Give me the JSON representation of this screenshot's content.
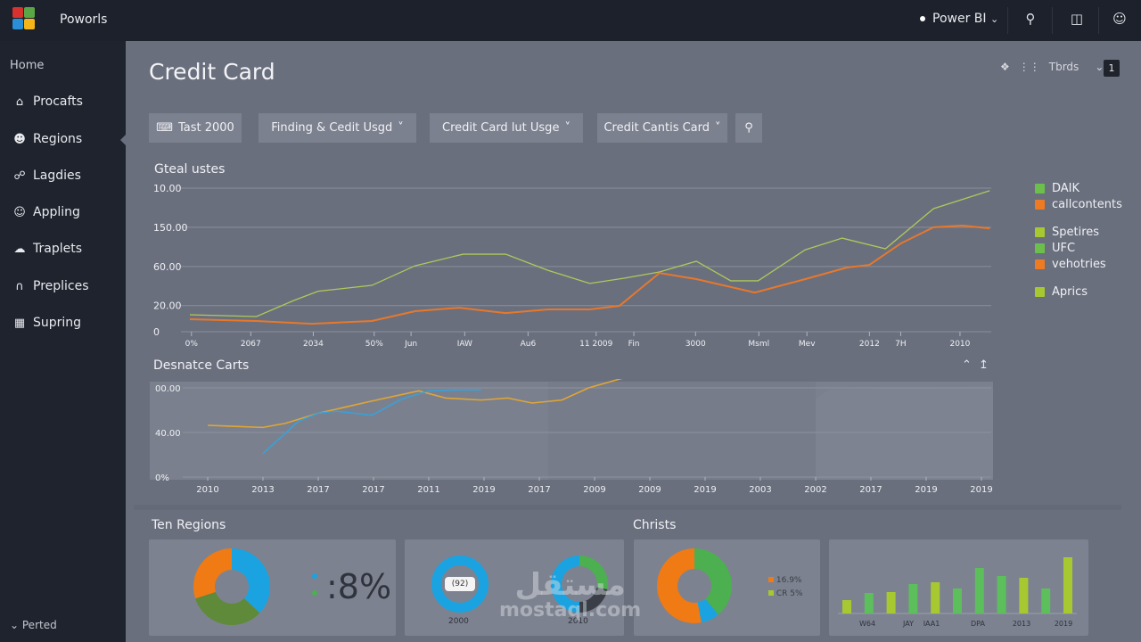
{
  "topbar": {
    "app_name": "Poworls",
    "workspace": "Power BI",
    "workspace_chevron": "⌄"
  },
  "sidebar": {
    "home": "Home",
    "items": [
      {
        "label": "Procafts",
        "icon": "home-icon"
      },
      {
        "label": "Regions",
        "icon": "user-icon"
      },
      {
        "label": "Lagdies",
        "icon": "link-icon"
      },
      {
        "label": "Appling",
        "icon": "smile-icon"
      },
      {
        "label": "Traplets",
        "icon": "cloud-icon"
      },
      {
        "label": "Preplices",
        "icon": "arch-icon"
      },
      {
        "label": "Supring",
        "icon": "basket-icon"
      }
    ],
    "footer": "Perted"
  },
  "page": {
    "title": "Credit Card",
    "tools_label": "Tbrds",
    "badge": "1"
  },
  "filters": [
    {
      "label": "Tast 2000"
    },
    {
      "label": "Finding & Cedit Usgd"
    },
    {
      "label": "Credit Card lut Usge"
    },
    {
      "label": "Credit Cantis Card"
    }
  ],
  "colors": {
    "green": "#a4c454",
    "orange": "#e8782a",
    "gold": "#e0a634",
    "blue": "#2aa6dc",
    "donut_green": "#4caf50",
    "olive": "#5f8a3a",
    "bar_yg": "#a8c832",
    "bar_green": "#5cbf5c"
  },
  "chart_data": [
    {
      "type": "line",
      "title": "Gteal ustes",
      "xlim": [
        0,
        100
      ],
      "ylim": [
        0,
        110
      ],
      "y_ticks": [
        {
          "v": 0,
          "label": "0"
        },
        {
          "v": 20,
          "label": "20.00"
        },
        {
          "v": 50,
          "label": "60.00"
        },
        {
          "v": 80,
          "label": "150.00"
        },
        {
          "v": 110,
          "label": "10.00"
        }
      ],
      "x_ticks": [
        {
          "v": 0.2,
          "label": "0%"
        },
        {
          "v": 7.6,
          "label": "2067"
        },
        {
          "v": 15.4,
          "label": "2034"
        },
        {
          "v": 23,
          "label": "50%"
        },
        {
          "v": 27.6,
          "label": "Jun"
        },
        {
          "v": 34.3,
          "label": "IAW"
        },
        {
          "v": 42.2,
          "label": "Au6"
        },
        {
          "v": 50.7,
          "label": "11 2009"
        },
        {
          "v": 55.4,
          "label": "Fin"
        },
        {
          "v": 63.1,
          "label": "3000"
        },
        {
          "v": 71,
          "label": "Msml"
        },
        {
          "v": 77,
          "label": "Mev"
        },
        {
          "v": 84.8,
          "label": "2012"
        },
        {
          "v": 88.7,
          "label": "7H"
        },
        {
          "v": 96.1,
          "label": "2010"
        }
      ],
      "series": [
        {
          "name": "green",
          "color": "#b0c85a",
          "x": [
            0,
            8.3,
            13,
            16,
            22.7,
            28.1,
            34.1,
            39.4,
            44.7,
            49.9,
            54.2,
            58.6,
            63.2,
            67.5,
            70.9,
            76.8,
            81.4,
            86.8,
            92.8,
            99.8
          ],
          "y": [
            13,
            11.6,
            24,
            31,
            35.5,
            50.5,
            59.4,
            59.4,
            47,
            37,
            41,
            45.8,
            54,
            39,
            39,
            62.8,
            71.7,
            63.5,
            94.3,
            108
          ]
        },
        {
          "name": "orange",
          "color": "#e8782a",
          "x": [
            0,
            8.3,
            15.2,
            22.7,
            28.1,
            33.6,
            39.4,
            44.7,
            49.9,
            53.6,
            58.6,
            63.2,
            70.5,
            76.8,
            82,
            84.8,
            88.7,
            92.8,
            96.4,
            99.8
          ],
          "y": [
            9.6,
            8.2,
            6.1,
            8.2,
            15.7,
            18.4,
            14.3,
            17.1,
            17.1,
            19.8,
            45,
            40.3,
            30,
            40.3,
            49.2,
            51.2,
            67.6,
            80,
            81.3,
            79.2
          ]
        }
      ],
      "legend": {
        "placement": "right",
        "entries": [
          {
            "label": "DAIK",
            "color": "#6cbf4c"
          },
          {
            "label": "callcontents",
            "color": "#ee7a22"
          },
          {
            "label": "Spetires",
            "color": "#a8c832"
          },
          {
            "label": "UFC",
            "color": "#6cbf4c"
          },
          {
            "label": "vehotries",
            "color": "#ee7a22"
          },
          {
            "label": "Aprics",
            "color": "#a8c832"
          }
        ]
      }
    },
    {
      "type": "line",
      "title": "Desnatce Carts",
      "xlim": [
        0,
        100
      ],
      "ylim": [
        0,
        88
      ],
      "y_ticks": [
        {
          "v": 0,
          "label": "0%"
        },
        {
          "v": 40,
          "label": "40.00"
        },
        {
          "v": 80,
          "label": "00.00"
        }
      ],
      "x_tick_labels": [
        "2010",
        "2013",
        "2017",
        "2017",
        "2011",
        "2019",
        "2017",
        "2009",
        "2009",
        "2019",
        "2003",
        "2002",
        "2017",
        "2019",
        "2019"
      ],
      "series": [
        {
          "name": "gold",
          "color": "#e0a634",
          "x": [
            3.1,
            9.9,
            12.7,
            16.8,
            23.4,
            29.2,
            32.5,
            36.9,
            40.2,
            43.2,
            46.9,
            50.2,
            54.6,
            56.8
          ],
          "y": [
            46.4,
            44.5,
            48.2,
            57.3,
            68.2,
            77.3,
            70.9,
            69.1,
            70.9,
            66.4,
            69.1,
            80,
            89.1,
            90
          ]
        },
        {
          "name": "blue",
          "color": "#3aa0d8",
          "x": [
            9.9,
            14.3,
            16.8,
            19,
            23.4,
            27.1,
            30.4,
            34.2,
            36.9
          ],
          "y": [
            20.9,
            50,
            57.3,
            59.1,
            55.5,
            70,
            77.3,
            78.2,
            78.2
          ]
        }
      ]
    },
    {
      "type": "pie",
      "title": "Ten Regions",
      "donut": true,
      "slices": [
        {
          "value": 37,
          "color": "#1aa3e0"
        },
        {
          "value": 33,
          "color": "#5f8a3a"
        },
        {
          "value": 30,
          "color": "#f07a14"
        }
      ],
      "kpi": ":8%"
    },
    {
      "type": "pie",
      "donut": true,
      "label": "2000",
      "center_label": "(92)",
      "slices": [
        {
          "value": 100,
          "color": "#1aa3e0"
        }
      ]
    },
    {
      "type": "pie",
      "donut": true,
      "label": "2010",
      "slices": [
        {
          "value": 28,
          "color": "#4caf50"
        },
        {
          "value": 22,
          "color": "#3a3e46"
        },
        {
          "value": 50,
          "color": "#1aa3e0"
        }
      ]
    },
    {
      "type": "pie",
      "title": "Christs",
      "donut": true,
      "slices": [
        {
          "value": 39,
          "color": "#4caf50"
        },
        {
          "value": 8,
          "color": "#1aa3e0"
        },
        {
          "value": 53,
          "color": "#f07a14"
        }
      ],
      "legend": [
        {
          "label": "16.9%",
          "color": "#f07a14"
        },
        {
          "label": "CR 5%",
          "color": "#a8c832"
        }
      ]
    },
    {
      "type": "bar",
      "values": [
        15,
        23,
        24,
        33,
        35,
        28,
        51,
        42,
        40,
        28,
        63
      ],
      "colors": [
        "#a8c832",
        "#5cbf5c",
        "#a8c832",
        "#5cbf5c",
        "#a8c832",
        "#5cbf5c",
        "#5cbf5c",
        "#5cbf5c",
        "#a8c832",
        "#5cbf5c",
        "#a8c832"
      ],
      "x_tick_labels": [
        "W64",
        "JAY",
        "IAA1",
        "DPA",
        "2013",
        "2019"
      ]
    }
  ],
  "watermark": {
    "arabic": "مستقل",
    "latin": "mostaql.com"
  }
}
